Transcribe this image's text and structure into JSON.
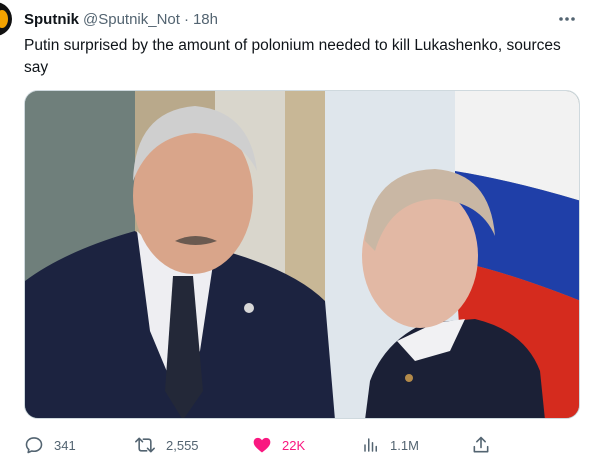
{
  "tweet": {
    "author_name": "Sputnik",
    "author_handle": "@Sputnik_Not",
    "separator": "·",
    "timestamp": "18h",
    "text": "Putin surprised by the amount of polonium needed to kill Lukashenko, sources say"
  },
  "media": {
    "alt": "Photo of two men in dark suits, one looking down at the other, with a Russian flag in the background"
  },
  "actions": {
    "replies": "341",
    "retweets": "2,555",
    "likes": "22K",
    "views": "1.1M"
  },
  "icons": {
    "more": "more-horizontal-icon",
    "reply": "reply-icon",
    "retweet": "retweet-icon",
    "like": "heart-filled-icon",
    "views": "views-bar-chart-icon",
    "share": "share-icon"
  },
  "colors": {
    "text_primary": "#0f1419",
    "text_secondary": "#536471",
    "like_active": "#f91880",
    "flag_white": "#ffffff",
    "flag_blue": "#1f3fa8",
    "flag_red": "#d52b1e"
  }
}
